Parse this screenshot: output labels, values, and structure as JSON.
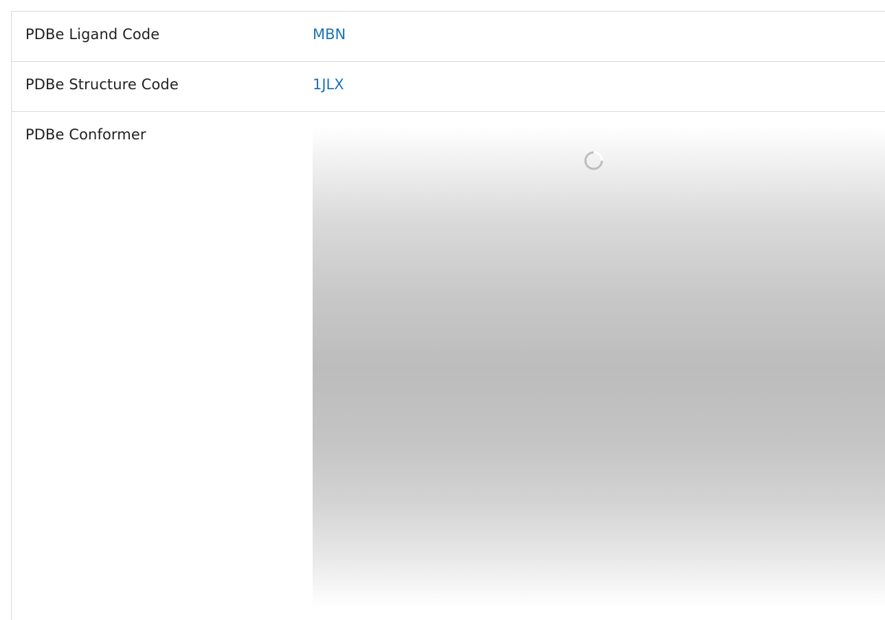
{
  "rows": [
    {
      "label": "PDBe Ligand Code",
      "value": "MBN"
    },
    {
      "label": "PDBe Structure Code",
      "value": "1JLX"
    },
    {
      "label": "PDBe Conformer"
    }
  ],
  "colors": {
    "link": "#1a73b9",
    "border": "#d9d9d9",
    "spinner": "#bdbdbd"
  },
  "icons": {
    "loading": "loading-spinner-icon"
  }
}
